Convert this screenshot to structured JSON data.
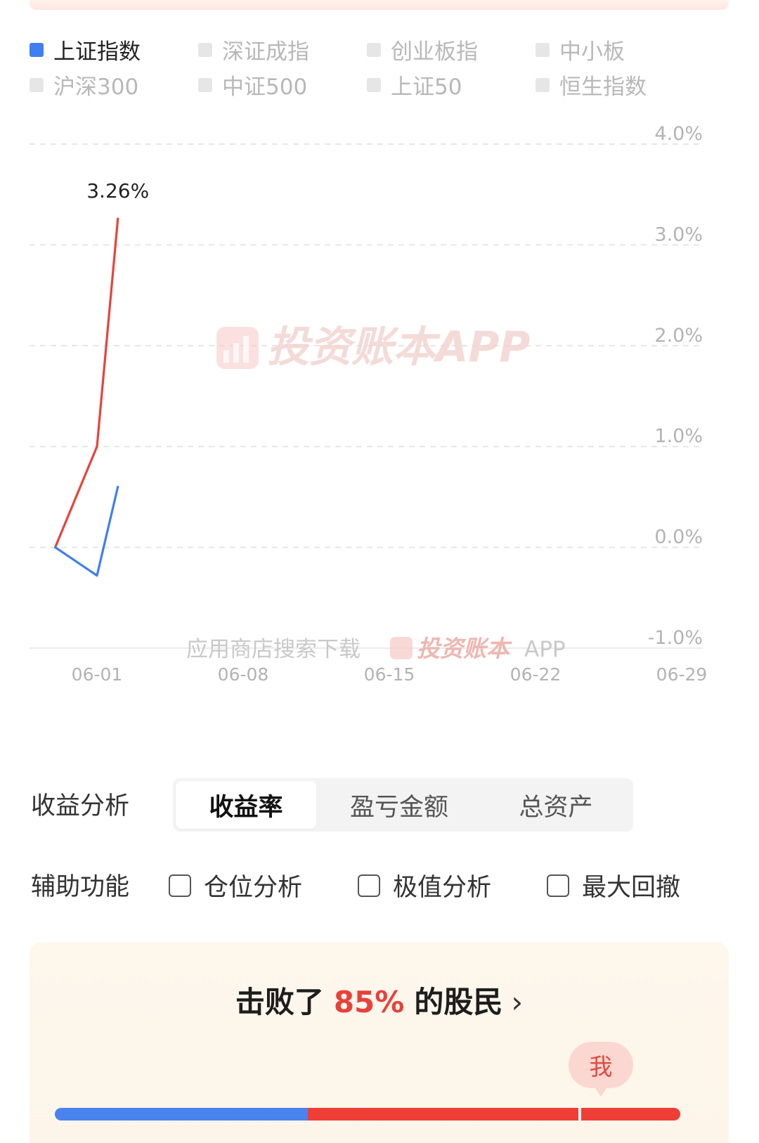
{
  "legend": [
    {
      "label": "上证指数",
      "active": true
    },
    {
      "label": "深证成指",
      "active": false
    },
    {
      "label": "创业板指",
      "active": false
    },
    {
      "label": "中小板",
      "active": false
    },
    {
      "label": "沪深300",
      "active": false
    },
    {
      "label": "中证500",
      "active": false
    },
    {
      "label": "上证50",
      "active": false
    },
    {
      "label": "恒生指数",
      "active": false
    }
  ],
  "chart_data": {
    "type": "line",
    "x_tick_labels": [
      "06-01",
      "06-08",
      "06-15",
      "06-22",
      "06-29"
    ],
    "y_tick_labels": [
      "4.0%",
      "3.0%",
      "2.0%",
      "1.0%",
      "0.0%",
      "-1.0%"
    ],
    "ylim": [
      -1.0,
      4.0
    ],
    "grid": true,
    "series": [
      {
        "color": "#e8433a",
        "points": [
          {
            "x": "05-29",
            "y": 0.0
          },
          {
            "x": "06-01",
            "y": 1.0
          },
          {
            "x": "06-02",
            "y": 3.26
          }
        ]
      },
      {
        "name": "上证指数",
        "color": "#3f7ef3",
        "points": [
          {
            "x": "05-29",
            "y": 0.0
          },
          {
            "x": "06-01",
            "y": -0.28
          },
          {
            "x": "06-02",
            "y": 0.6
          }
        ]
      }
    ],
    "annotation": "3.26%"
  },
  "watermark": {
    "main": "投资账本APP",
    "footer_prefix": "应用商店搜索下载",
    "footer_brand": "投资账本",
    "footer_suffix": "APP"
  },
  "analysis": {
    "label": "收益分析",
    "tabs": [
      "收益率",
      "盈亏金额",
      "总资产"
    ],
    "active_tab": 0
  },
  "aux": {
    "label": "辅助功能",
    "options": [
      "仓位分析",
      "极值分析",
      "最大回撤"
    ]
  },
  "beat": {
    "prefix": "击败了",
    "percent": "85%",
    "suffix": "的股民",
    "chevron": "›",
    "me": "我"
  },
  "colors": {
    "blue": "#3f7ef3",
    "red": "#e8433a"
  }
}
